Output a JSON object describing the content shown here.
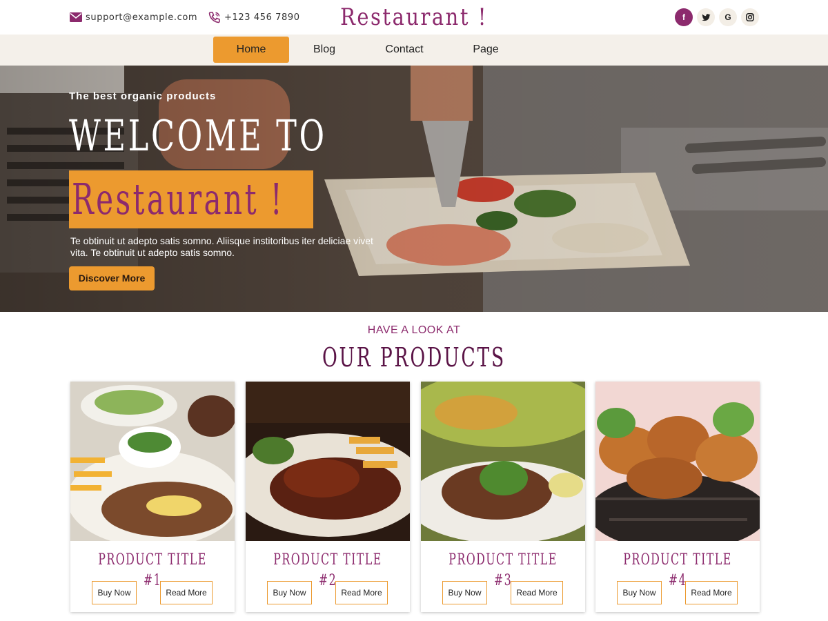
{
  "header": {
    "email": "support@example.com",
    "phone": "+123 456 7890",
    "brand": "Restaurant !",
    "social": [
      {
        "name": "facebook-icon",
        "glyph": "f"
      },
      {
        "name": "twitter-icon",
        "glyph": "🐦"
      },
      {
        "name": "google-icon",
        "glyph": "G"
      },
      {
        "name": "instagram-icon",
        "glyph": "◎"
      }
    ]
  },
  "nav": {
    "items": [
      {
        "label": "Home",
        "active": true
      },
      {
        "label": "Blog"
      },
      {
        "label": "Contact"
      },
      {
        "label": "Page"
      }
    ]
  },
  "hero": {
    "kicker": "The best organic products",
    "welcome": "WELCOME TO",
    "highlight": "Restaurant !",
    "description": "Te obtinuit ut adepto satis somno. Aliisque institoribus iter deliciae vivet vita. Te obtinuit ut adepto satis somno.",
    "cta_label": "Discover More"
  },
  "products": {
    "eyebrow": "HAVE A LOOK AT",
    "title": "OUR PRODUCTS",
    "items": [
      {
        "title": "PRODUCT TITLE #1",
        "buy": "Buy Now",
        "read": "Read More"
      },
      {
        "title": "PRODUCT TITLE #2",
        "buy": "Buy Now",
        "read": "Read More"
      },
      {
        "title": "PRODUCT TITLE #3",
        "buy": "Buy Now",
        "read": "Read More"
      },
      {
        "title": "PRODUCT TITLE #4",
        "buy": "Buy Now",
        "read": "Read More"
      }
    ]
  },
  "colors": {
    "brand_purple": "#8c2a6d",
    "accent_orange": "#ec9a2f",
    "nav_bg": "#f4f0ea"
  }
}
